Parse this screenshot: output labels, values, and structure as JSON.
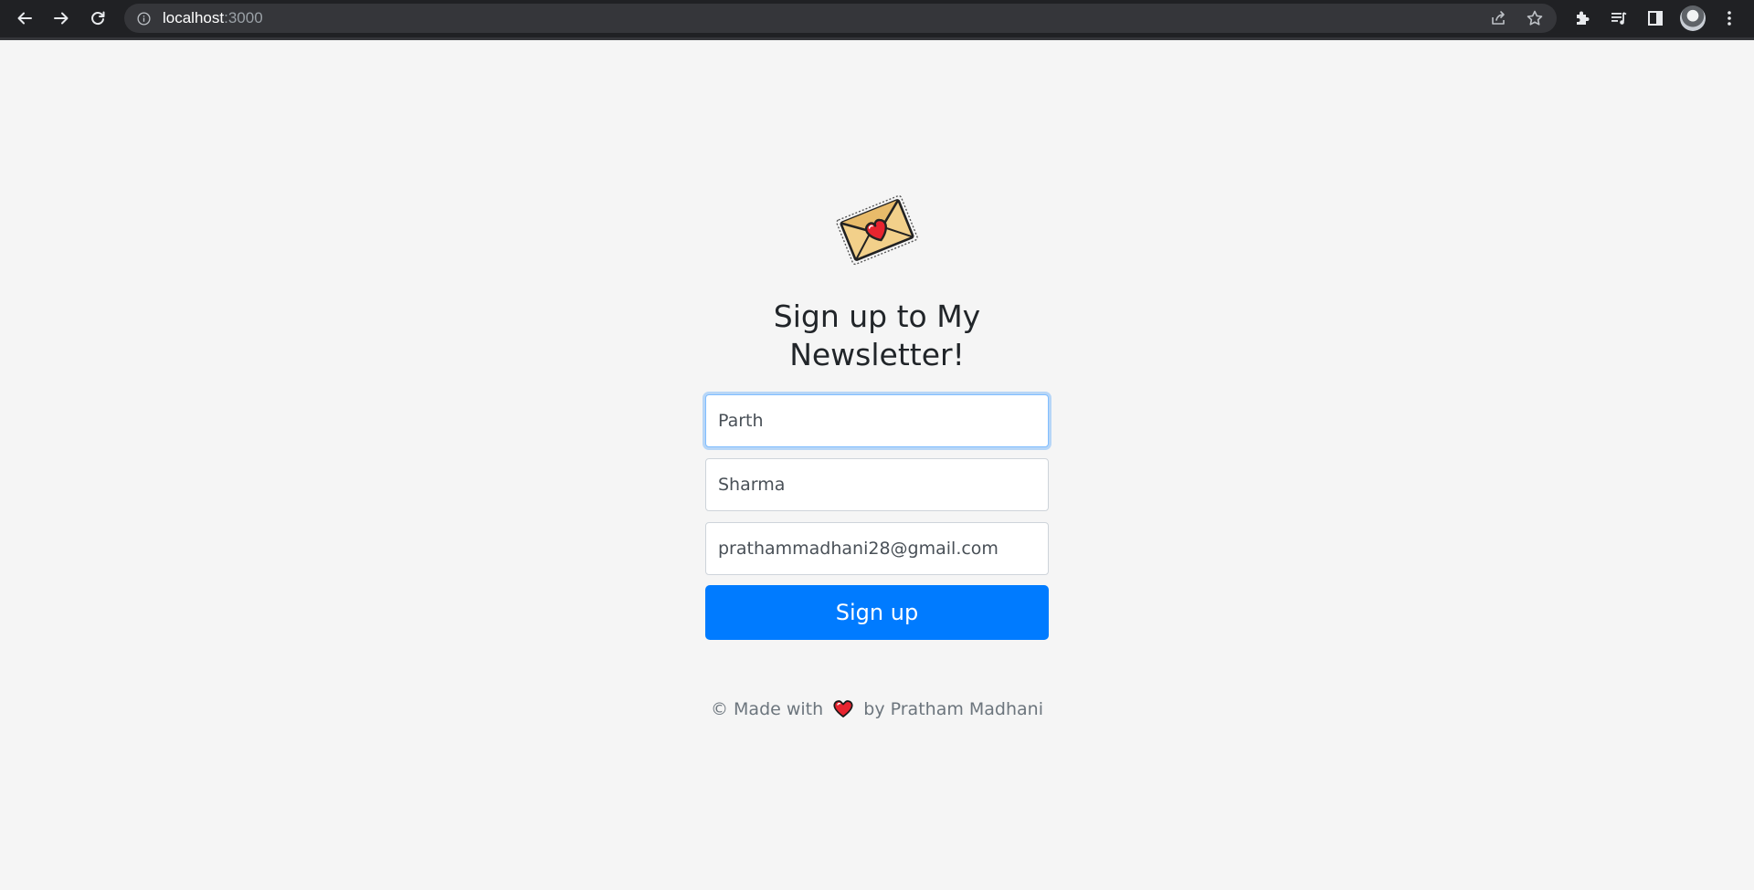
{
  "browser": {
    "url_host": "localhost",
    "url_port": ":3000",
    "icons": {
      "back": "back-arrow-icon",
      "forward": "forward-arrow-icon",
      "reload": "reload-icon",
      "site_info": "info-icon",
      "share": "share-icon",
      "bookmark": "star-icon",
      "extensions": "puzzle-icon",
      "media": "media-queue-icon",
      "side_panel": "side-panel-icon",
      "menu": "kebab-menu-icon"
    }
  },
  "form": {
    "logo": "envelope-heart-icon",
    "heading": "Sign up to My Newsletter!",
    "first_name_value": "Parth",
    "last_name_value": "Sharma",
    "email_value": "prathammadhani28@gmail.com",
    "submit_label": "Sign up"
  },
  "footer": {
    "prefix": "© Made with",
    "suffix": "by Pratham Madhani",
    "heart_icon": "heart-icon"
  },
  "colors": {
    "primary": "#007bff",
    "page_bg": "#f5f5f5",
    "chrome_bg": "#202124",
    "heart": "#e8242f",
    "envelope": "#f2d08a"
  }
}
